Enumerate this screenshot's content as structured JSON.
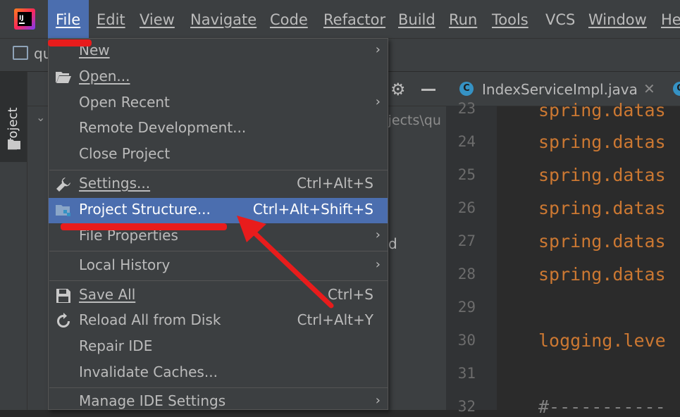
{
  "menubar": {
    "items": [
      {
        "label": "File",
        "active": true
      },
      {
        "label": "Edit"
      },
      {
        "label": "View"
      },
      {
        "label": "Navigate"
      },
      {
        "label": "Code"
      },
      {
        "label": "Refactor"
      },
      {
        "label": "Build"
      },
      {
        "label": "Run"
      },
      {
        "label": "Tools"
      },
      {
        "label": "VCS"
      },
      {
        "label": "Window"
      },
      {
        "label": "He"
      }
    ]
  },
  "toolbar": {
    "module_name": "qu"
  },
  "left_stripe": {
    "project_tab": "Project"
  },
  "project_panel": {
    "path_text": "ojects\\qu",
    "tree_text": "d"
  },
  "editor": {
    "tab": {
      "label": "IndexServiceImpl.java",
      "class_icon": "C"
    },
    "line_numbers": [
      "23",
      "24",
      "25",
      "26",
      "27",
      "28",
      "29",
      "30",
      "31",
      "32"
    ],
    "code_lines": [
      "spring.datas",
      "spring.datas",
      "spring.datas",
      "spring.datas",
      "spring.datas",
      "spring.datas",
      "",
      "logging.leve",
      "",
      "#-----------"
    ]
  },
  "file_menu": {
    "items": {
      "new": {
        "label": "New",
        "submenu": true
      },
      "open": {
        "label": "Open...",
        "icon": "folder-open-icon"
      },
      "open_recent": {
        "label": "Open Recent",
        "submenu": true
      },
      "remote_dev": {
        "label": "Remote Development..."
      },
      "close_project": {
        "label": "Close Project"
      },
      "settings": {
        "label": "Settings...",
        "shortcut": "Ctrl+Alt+S",
        "icon": "wrench-icon"
      },
      "project_structure": {
        "label": "Project Structure...",
        "shortcut": "Ctrl+Alt+Shift+S",
        "icon": "project-structure-icon",
        "highlighted": true
      },
      "file_properties": {
        "label": "File Properties",
        "submenu": true
      },
      "local_history": {
        "label": "Local History",
        "submenu": true
      },
      "save_all": {
        "label": "Save All",
        "shortcut": "Ctrl+S",
        "icon": "save-icon"
      },
      "reload": {
        "label": "Reload All from Disk",
        "shortcut": "Ctrl+Alt+Y",
        "icon": "reload-icon"
      },
      "repair": {
        "label": "Repair IDE"
      },
      "invalidate": {
        "label": "Invalidate Caches..."
      },
      "manage_settings": {
        "label": "Manage IDE Settings",
        "submenu": true
      }
    }
  },
  "colors": {
    "menu_bg": "#3c3f41",
    "highlight": "#4b6eaf",
    "annotation_red": "#e81c1c",
    "code_keyword": "#cc7832"
  }
}
